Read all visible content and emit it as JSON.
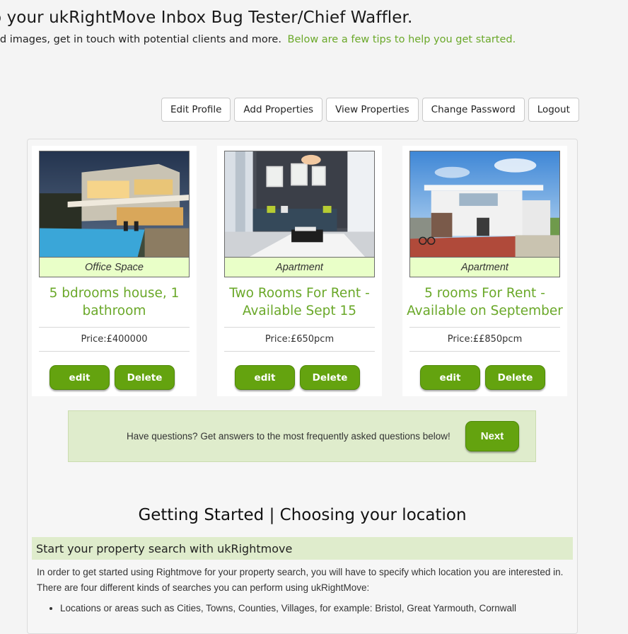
{
  "header": {
    "welcome": "o your ukRightMove Inbox Bug Tester/Chief Waffler.",
    "subtitle": "ad images, get in touch with potential clients and more.",
    "tips_link": "Below are a few tips to help you get started."
  },
  "nav": {
    "edit_profile": "Edit Profile",
    "add_properties": "Add Properties",
    "view_properties": "View Properties",
    "change_password": "Change Password",
    "logout": "Logout"
  },
  "properties": [
    {
      "type": "Office Space",
      "title": "5 bdrooms house, 1 bathroom",
      "price": "Price:£400000",
      "edit": "edit",
      "delete": "Delete"
    },
    {
      "type": "Apartment",
      "title": "Two Rooms For Rent - Available Sept 15",
      "price": "Price:£650pcm",
      "edit": "edit",
      "delete": "Delete"
    },
    {
      "type": "Apartment",
      "title": "5 rooms For Rent - Available on September",
      "price": "Price:££850pcm",
      "edit": "edit",
      "delete": "Delete"
    }
  ],
  "faq": {
    "question": "Have questions? Get answers to the most frequently asked questions below!",
    "next": "Next"
  },
  "getting_started": {
    "title": "Getting Started | Choosing your location",
    "subheading": "Start your property search with ukRightmove",
    "paragraph_1": "In order to get started using Rightmove for your property search, you will have to specify which location you are interested in.",
    "paragraph_2": "There are four different kinds of searches you can perform using ukRightMove:",
    "list_item_1": "Locations or areas such as Cities, Towns, Counties, Villages, for example: Bristol, Great Yarmouth, Cornwall"
  },
  "colors": {
    "accent_green": "#6aa829",
    "button_green": "#64a30f",
    "type_label_bg": "#e9ffc8",
    "faq_bg": "#dfeccc"
  }
}
